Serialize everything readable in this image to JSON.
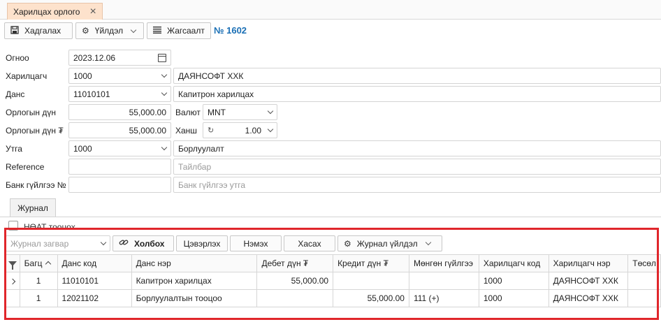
{
  "tab": {
    "title": "Харилцах орлого",
    "close": "×"
  },
  "toolbar": {
    "save_label": "Хадгалах",
    "actions_label": "Үйлдэл",
    "list_label": "Жагсаалт",
    "doc_number": "№ 1602"
  },
  "form": {
    "date": {
      "label": "Огноо",
      "value": "2023.12.06"
    },
    "partner": {
      "label": "Харилцагч",
      "code": "1000",
      "name": "ДАЯНСОФТ ХХК"
    },
    "account": {
      "label": "Данс",
      "code": "11010101",
      "name": "Капитрон харилцах"
    },
    "amount": {
      "label": "Орлогын дүн",
      "value": "55,000.00"
    },
    "currency": {
      "label": "Валют",
      "value": "MNT"
    },
    "amount_mnt": {
      "label": "Орлогын дүн ₮",
      "value": "55,000.00"
    },
    "rate": {
      "label": "Ханш",
      "value": "1.00"
    },
    "contra": {
      "label": "Утга",
      "code": "1000",
      "name": "Борлуулалт"
    },
    "reference": {
      "label": "Reference",
      "value": "",
      "description_placeholder": "Тайлбар"
    },
    "bank_tx": {
      "label": "Банк гүйлгээ №",
      "value": "",
      "note_placeholder": "Банк гүйлгээ утга"
    }
  },
  "journal_tab": "Журнал",
  "vat_label": "НӨАТ тооцох",
  "grid_toolbar": {
    "template_placeholder": "Журнал загвар",
    "link_label": "Холбох",
    "clear_label": "Цэвэрлэх",
    "add_label": "Нэмэх",
    "remove_label": "Хасах",
    "journal_actions_label": "Журнал үйлдэл"
  },
  "grid": {
    "columns": [
      "Багц",
      "Данс код",
      "Данс нэр",
      "Дебет дүн ₮",
      "Кредит дүн ₮",
      "Мөнгөн гүйлгээ",
      "Харилцагч код",
      "Харилцагч нэр",
      "Төсөл"
    ],
    "rows": [
      [
        "1",
        "11010101",
        "Капитрон харилцах",
        "55,000.00",
        "",
        "",
        "1000",
        "ДАЯНСОФТ ХХК",
        ""
      ],
      [
        "1",
        "12021102",
        "Борлуулалтын тооцоо",
        "",
        "55,000.00",
        "111 (+)",
        "1000",
        "ДАЯНСОФТ ХХК",
        ""
      ]
    ]
  },
  "colors": {
    "accent": "#1a6fb5",
    "tab_bg": "#fde2cc",
    "highlight": "#e0262b"
  }
}
